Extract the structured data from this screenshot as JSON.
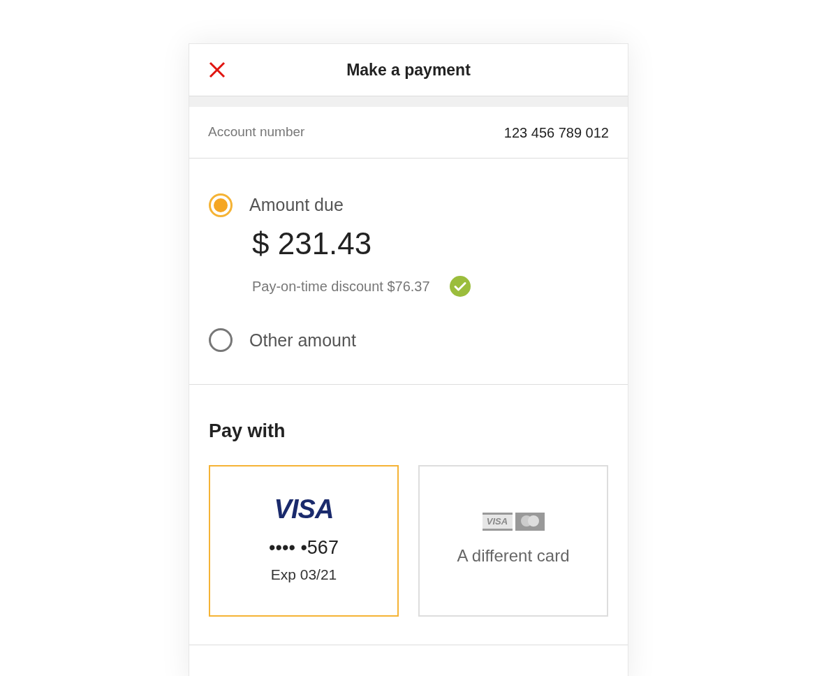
{
  "header": {
    "title": "Make a payment"
  },
  "account": {
    "label": "Account number",
    "value": "123 456 789 012"
  },
  "amount_options": [
    {
      "kind": "due",
      "label": "Amount due",
      "amount": "$ 231.43",
      "discount": "Pay-on-time discount $76.37",
      "selected": true
    },
    {
      "kind": "other",
      "label": "Other amount",
      "selected": false
    }
  ],
  "pay_with": {
    "title": "Pay with",
    "cards": [
      {
        "kind": "saved",
        "brand": "VISA",
        "number": "•••• •567",
        "expiry": "Exp 03/21",
        "selected": true
      },
      {
        "kind": "new",
        "brand": "VISA",
        "label": "A different card",
        "selected": false
      }
    ]
  }
}
